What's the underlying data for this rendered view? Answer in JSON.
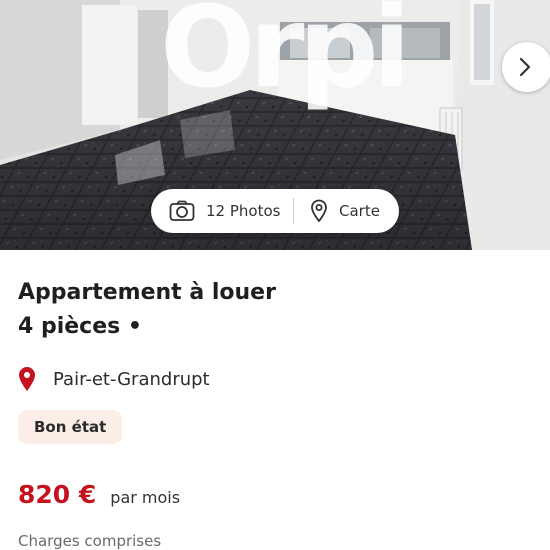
{
  "gallery": {
    "watermark": "Orpi",
    "next_icon": "chevron-right-icon",
    "photos_count_label": "12 Photos",
    "photos_icon": "camera-icon",
    "map_label": "Carte",
    "map_icon": "map-pin-outline-icon"
  },
  "listing": {
    "title_line1": "Appartement à louer",
    "title_line2": "4 pièces •",
    "location_icon": "location-pin-icon",
    "location": "Pair-et-Grandrupt",
    "condition_badge": "Bon état",
    "price": "820 €",
    "price_period": "par mois",
    "charges_note": "Charges comprises"
  },
  "colors": {
    "accent_red": "#c4131f",
    "badge_background": "#fbeee6"
  }
}
